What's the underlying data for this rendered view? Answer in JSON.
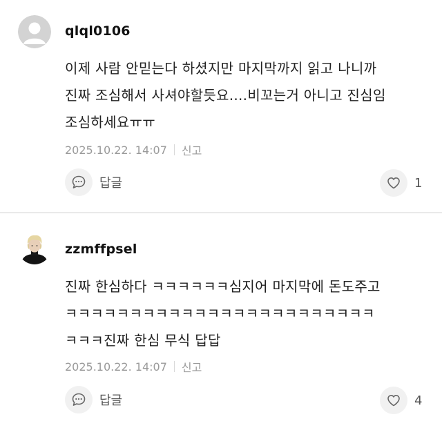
{
  "comments": [
    {
      "username": "qlql0106",
      "avatar": "default-avatar",
      "text": "이제 사람 안믿는다 하셨지만 마지막까지 읽고 나니까\n진짜 조심해서 사셔야할듯요....비꼬는거 아니고 진심임\n조심하세요ㅠㅠ",
      "date": "2025.10.22. 14:07",
      "report_label": "신고",
      "reply_label": "답글",
      "reply_icon": "speech-bubble-icon",
      "like_icon": "heart-icon",
      "likes": "1"
    },
    {
      "username": "zzmffpsel",
      "avatar": "profile-photo",
      "text": "진짜 한심하다 ㅋㅋㅋㅋㅋㅋ심지어 마지막에 돈도주고\nㅋㅋㅋㅋㅋㅋㅋㅋㅋㅋㅋㅋㅋㅋㅋㅋㅋㅋㅋㅋㅋㅋㅋㅋ\nㅋㅋㅋ진짜 한심 무식 답답",
      "date": "2025.10.22. 14:07",
      "report_label": "신고",
      "reply_label": "답글",
      "reply_icon": "speech-bubble-icon",
      "like_icon": "heart-icon",
      "likes": "4"
    }
  ],
  "colors": {
    "background": "#ffffff",
    "meta_text": "#9a9a9a",
    "icon_bg": "#f1f1f1",
    "divider": "#e9e9e9"
  }
}
